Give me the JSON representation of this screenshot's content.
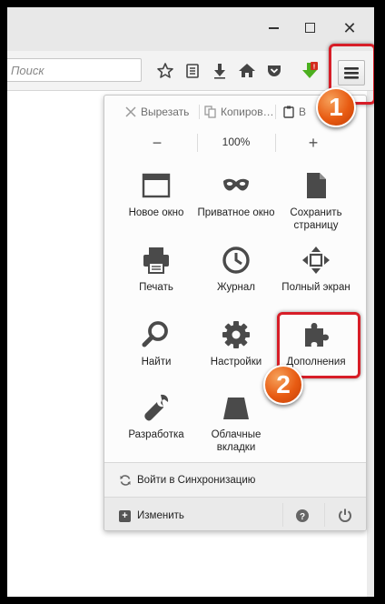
{
  "window": {
    "buttons": {
      "minimize": "minimize",
      "maximize": "maximize",
      "close": "close"
    }
  },
  "toolbar": {
    "search_placeholder": "Поиск",
    "icons": [
      "bookmark-star-icon",
      "reading-list-icon",
      "download-icon",
      "home-icon",
      "pocket-icon",
      "addon-download-icon",
      "hamburger-menu-icon"
    ]
  },
  "panel": {
    "edit": {
      "cut": "Вырезать",
      "copy": "Копиров…",
      "paste": "В"
    },
    "zoom": {
      "minus": "−",
      "level": "100%",
      "plus": "+"
    },
    "items": [
      {
        "label": "Новое окно",
        "icon": "new-window-icon"
      },
      {
        "label": "Приватное окно",
        "icon": "private-mask-icon"
      },
      {
        "label": "Сохранить страницу",
        "icon": "save-page-icon"
      },
      {
        "label": "Печать",
        "icon": "printer-icon"
      },
      {
        "label": "Журнал",
        "icon": "history-clock-icon"
      },
      {
        "label": "Полный экран",
        "icon": "fullscreen-icon"
      },
      {
        "label": "Найти",
        "icon": "search-icon"
      },
      {
        "label": "Настройки",
        "icon": "gear-icon"
      },
      {
        "label": "Дополнения",
        "icon": "puzzle-icon"
      },
      {
        "label": "Разработка",
        "icon": "wrench-icon"
      },
      {
        "label": "Облачные вкладки",
        "icon": "cloud-tabs-icon"
      }
    ],
    "sync_label": "Войти в Синхронизацию",
    "customize_label": "Изменить"
  },
  "annotations": {
    "badge1": "1",
    "badge2": "2"
  },
  "colors": {
    "highlight": "#d71e28",
    "badge": "#e85b12"
  }
}
